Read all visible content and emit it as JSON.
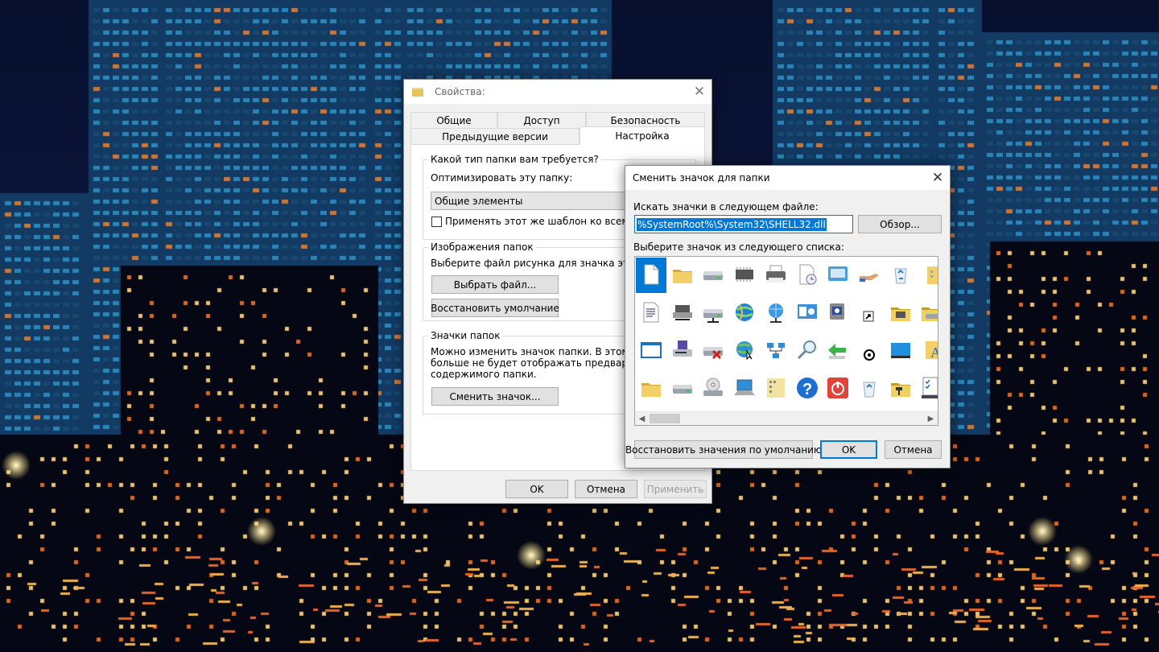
{
  "properties_window": {
    "title": "Свойства:",
    "tabs_row1": [
      "Общие",
      "Доступ",
      "Безопасность"
    ],
    "tabs_row2": [
      "Предыдущие версии",
      "Настройка"
    ],
    "active_tab": "Настройка",
    "folder_type_group": {
      "legend": "Какой тип папки вам требуется?",
      "optimize_label": "Оптимизировать эту папку:",
      "optimize_value": "Общие элементы",
      "apply_template_label": "Применять этот же шаблон ко всем подпапкам",
      "apply_template_checked": false
    },
    "folder_pictures_group": {
      "legend": "Изображения папок",
      "description": "Выберите файл рисунка для значка этой папки.",
      "choose_file_button": "Выбрать файл...",
      "restore_default_button": "Восстановить умолчание"
    },
    "folder_icons_group": {
      "legend": "Значки папок",
      "description_lines": [
        "Можно изменить значок папки. В этом случае",
        "больше не будет отображать предварительный просмотр",
        "содержимого папки."
      ],
      "change_icon_button": "Сменить значок..."
    },
    "buttons": {
      "ok": "OK",
      "cancel": "Отмена",
      "apply": "Применить"
    }
  },
  "change_icon_dialog": {
    "title": "Сменить значок для папки",
    "search_label": "Искать значки в следующем файле:",
    "file_path": "%SystemRoot%\\System32\\SHELL32.dll",
    "browse_button": "Обзор...",
    "list_label": "Выберите значок из следующего списка:",
    "icons": [
      [
        "blank-document-icon",
        "folder-icon",
        "drive-icon",
        "chip-icon",
        "printer-icon",
        "document-clock-icon",
        "monitor-app-icon",
        "hand-share-icon",
        "recycle-bin-icon",
        "folder-partial-icon"
      ],
      [
        "text-document-icon",
        "network-printer-icon",
        "network-drive-icon",
        "globe-ie-icon",
        "network-globe-icon",
        "control-panel-icon",
        "shortcut-app-icon",
        "shortcut-arrow-icon",
        "folder-settings-icon",
        "folder-drive-icon"
      ],
      [
        "window-icon",
        "floppy-drive-icon",
        "drive-remove-icon",
        "globe-cursor-icon",
        "network-blocks-icon",
        "magnifier-icon",
        "arrow-green-icon",
        "cd-small-icon",
        "desktop-screen-icon",
        "font-folder-icon"
      ],
      [
        "folder-yellow-icon",
        "optical-drive-icon",
        "cd-drive-icon",
        "laptop-icon",
        "document-grid-icon",
        "help-icon",
        "power-icon",
        "recycle-empty-icon",
        "folder-tools-icon",
        "checklist-icon"
      ]
    ],
    "selected_icon": "blank-document-icon",
    "restore_defaults_button": "Восстановить значения по умолчанию",
    "ok_button": "OK",
    "cancel_button": "Отмена"
  },
  "colors": {
    "accent": "#0078d7",
    "folder": "#e8c35a"
  }
}
